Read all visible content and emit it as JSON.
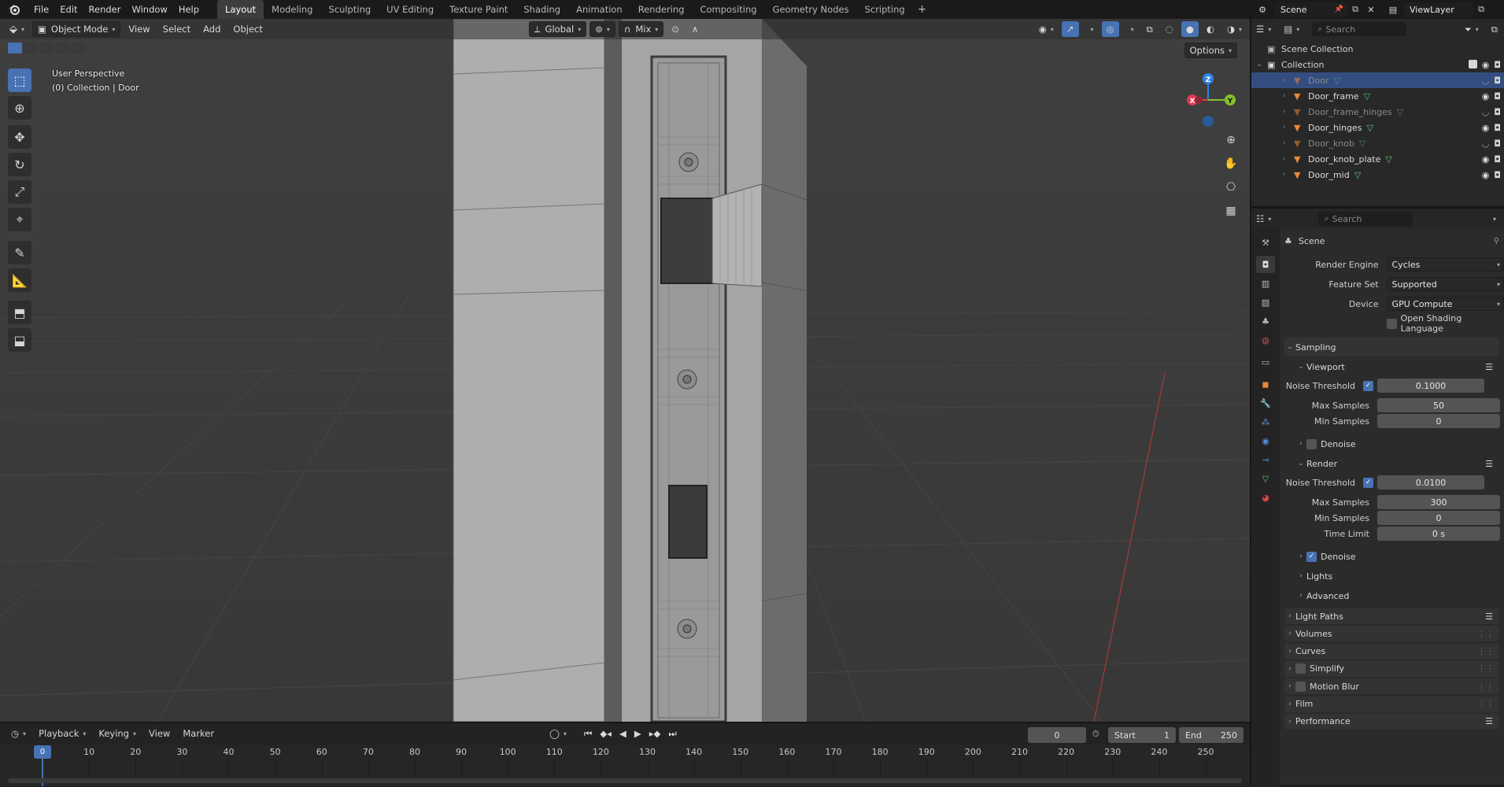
{
  "app": {
    "logo_icon": "blender-logo-icon"
  },
  "menu": [
    "File",
    "Edit",
    "Render",
    "Window",
    "Help"
  ],
  "workspaces": {
    "active_index": 0,
    "tabs": [
      "Layout",
      "Modeling",
      "Sculpting",
      "UV Editing",
      "Texture Paint",
      "Shading",
      "Animation",
      "Rendering",
      "Compositing",
      "Geometry Nodes",
      "Scripting"
    ],
    "add_label": "+"
  },
  "scene_selector": {
    "label": "Scene"
  },
  "viewlayer_selector": {
    "label": "ViewLayer"
  },
  "viewport": {
    "mode_label": "Object Mode",
    "menus": [
      "View",
      "Select",
      "Add",
      "Object"
    ],
    "transform_orientation": "Global",
    "snap_label": "Mix",
    "options_label": "Options",
    "overlay_title": "User Perspective",
    "overlay_subtitle": "(0) Collection | Door",
    "gizmo": {
      "x": "X",
      "y": "Y",
      "z": "Z"
    }
  },
  "outliner": {
    "search_placeholder": "Search",
    "scene_collection": "Scene Collection",
    "collection": "Collection",
    "objects": [
      {
        "name": "Door",
        "selected": true,
        "visible": false
      },
      {
        "name": "Door_frame",
        "selected": false,
        "visible": true
      },
      {
        "name": "Door_frame_hinges",
        "selected": false,
        "visible": false
      },
      {
        "name": "Door_hinges",
        "selected": false,
        "visible": true
      },
      {
        "name": "Door_knob",
        "selected": false,
        "visible": false
      },
      {
        "name": "Door_knob_plate",
        "selected": false,
        "visible": true
      },
      {
        "name": "Door_mid",
        "selected": false,
        "visible": true
      }
    ]
  },
  "properties": {
    "search_placeholder": "Search",
    "context_title": "Scene",
    "render_engine": {
      "label": "Render Engine",
      "value": "Cycles"
    },
    "feature_set": {
      "label": "Feature Set",
      "value": "Supported"
    },
    "device": {
      "label": "Device",
      "value": "GPU Compute"
    },
    "open_shading_language": {
      "label": "Open Shading Language",
      "checked": false
    },
    "sampling": {
      "label": "Sampling",
      "viewport": {
        "label": "Viewport",
        "noise_threshold_label": "Noise Threshold",
        "noise_threshold": "0.1000",
        "noise_threshold_enabled": true,
        "max_samples_label": "Max Samples",
        "max_samples": "50",
        "min_samples_label": "Min Samples",
        "min_samples": "0",
        "denoise_label": "Denoise",
        "denoise_checked": false
      },
      "render": {
        "label": "Render",
        "noise_threshold_label": "Noise Threshold",
        "noise_threshold": "0.0100",
        "noise_threshold_enabled": true,
        "max_samples_label": "Max Samples",
        "max_samples": "300",
        "min_samples_label": "Min Samples",
        "min_samples": "0",
        "time_limit_label": "Time Limit",
        "time_limit": "0 s",
        "denoise_label": "Denoise",
        "denoise_checked": true
      },
      "lights_label": "Lights",
      "advanced_label": "Advanced"
    },
    "panels": [
      {
        "label": "Light Paths",
        "checkbox": false,
        "list_icon": true
      },
      {
        "label": "Volumes",
        "checkbox": false,
        "list_icon": false
      },
      {
        "label": "Curves",
        "checkbox": false,
        "list_icon": false
      },
      {
        "label": "Simplify",
        "checkbox": true,
        "list_icon": false
      },
      {
        "label": "Motion Blur",
        "checkbox": true,
        "list_icon": false
      },
      {
        "label": "Film",
        "checkbox": false,
        "list_icon": false
      },
      {
        "label": "Performance",
        "checkbox": false,
        "list_icon": true
      }
    ]
  },
  "timeline": {
    "menus": [
      "Playback",
      "Keying",
      "View",
      "Marker"
    ],
    "current_frame": "0",
    "start_label": "Start",
    "start": "1",
    "end_label": "End",
    "end": "250",
    "ruler_ticks": [
      "0",
      "10",
      "20",
      "30",
      "40",
      "50",
      "60",
      "70",
      "80",
      "90",
      "100",
      "110",
      "120",
      "130",
      "140",
      "150",
      "160",
      "170",
      "180",
      "190",
      "200",
      "210",
      "220",
      "230",
      "240",
      "250"
    ]
  },
  "colors": {
    "accent": "#4772b3",
    "selection": "#334d80",
    "object_orange": "#e8883a",
    "mesh_green": "#5fc271",
    "axis_x": "#e0384f",
    "axis_y": "#84c22a",
    "axis_z": "#2f83e3"
  }
}
